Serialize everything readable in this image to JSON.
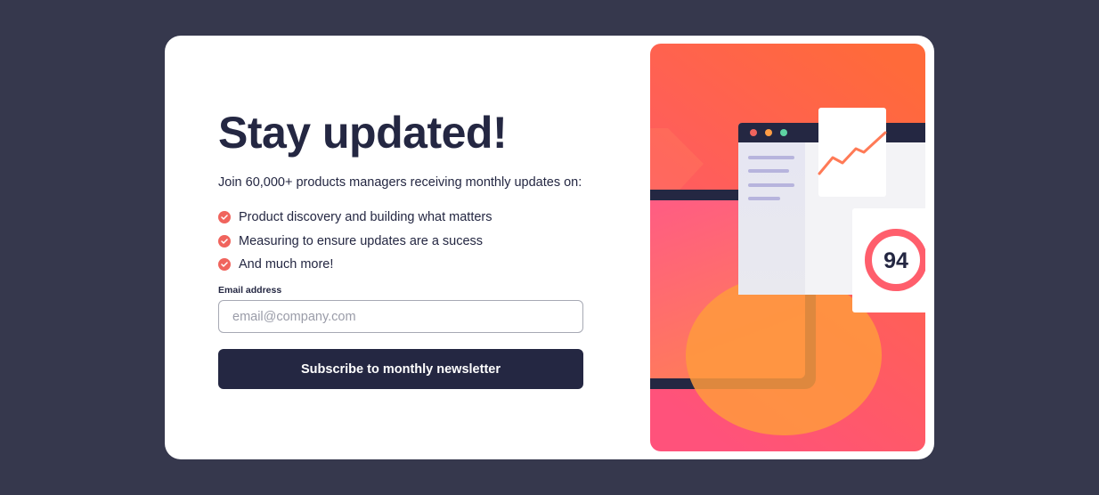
{
  "signup": {
    "title": "Stay updated!",
    "intro": "Join 60,000+ products managers receiving monthly updates on:",
    "benefits": [
      "Product discovery and building what matters",
      "Measuring to ensure updates are a sucess",
      "And much more!"
    ],
    "email_label": "Email address",
    "email_placeholder": "email@company.com",
    "email_value": "",
    "submit_label": "Subscribe to monthly newsletter"
  },
  "illustration": {
    "score": "94"
  },
  "colors": {
    "page_bg": "#36384d",
    "navy": "#242742",
    "tomato": "#f0645d",
    "gradient_top": "#ff6a3a",
    "gradient_bottom": "#ff527b"
  }
}
